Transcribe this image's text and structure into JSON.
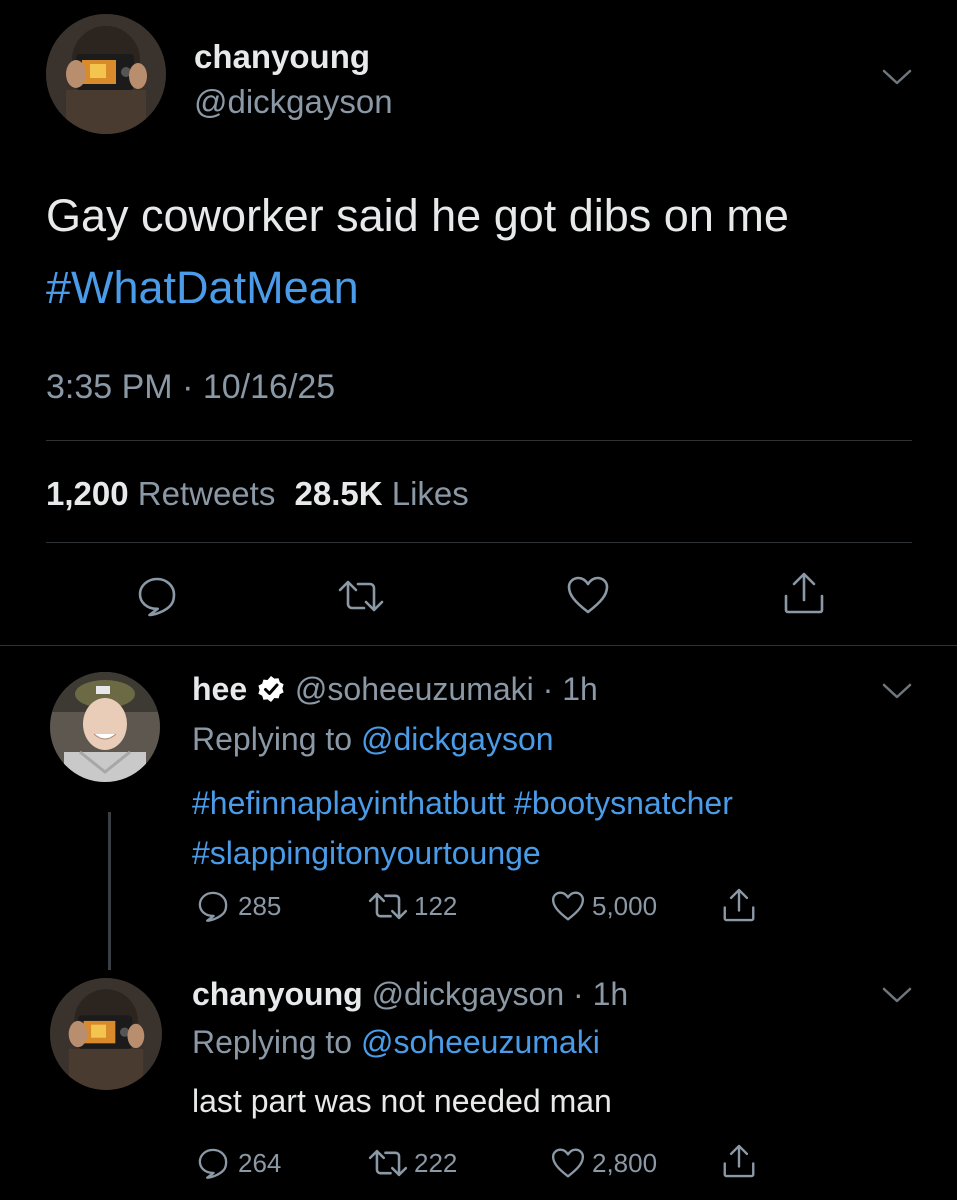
{
  "main_tweet": {
    "display_name": "chanyoung",
    "handle": "@dickgayson",
    "text": "Gay coworker said he got dibs on me",
    "hashtag": "#WhatDatMean",
    "time": "3:35 PM",
    "date": "10/16/25",
    "retweets_count": "1,200",
    "retweets_label": "Retweets",
    "likes_count": "28.5K",
    "likes_label": "Likes"
  },
  "reply1": {
    "display_name": "hee",
    "handle": "@soheeuzumaki",
    "age": "1h",
    "replying_prefix": "Replying to",
    "replying_to": "@dickgayson",
    "hashtag1": "#hefinnaplayinthatbutt",
    "hashtag2": "#bootysnatcher",
    "hashtag3": "#slappingitonyourtounge",
    "replies": "285",
    "retweets": "122",
    "likes": "5,000"
  },
  "reply2": {
    "display_name": "chanyoung",
    "handle": "@dickgayson",
    "age": "1h",
    "replying_prefix": "Replying to",
    "replying_to": "@soheeuzumaki",
    "text": "last part was not needed man",
    "replies": "264",
    "retweets": "222",
    "likes": "2,800"
  },
  "colors": {
    "background": "#000000",
    "link": "#4a9be8",
    "muted": "#8b98a5",
    "divider": "#2f3336"
  },
  "icons": [
    "chevron-down-icon",
    "reply-icon",
    "retweet-icon",
    "like-icon",
    "share-icon",
    "verified-badge-icon"
  ]
}
